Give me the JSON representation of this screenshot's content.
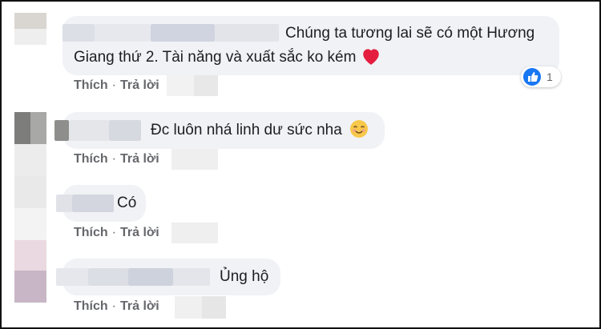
{
  "comments": [
    {
      "text_line1": "Chúng ta tương lai sẽ có một Hương",
      "text_line2": "Giang thứ 2. Tài năng và xuất sắc ko kém",
      "emoji": "red-heart",
      "reaction_count": "1"
    },
    {
      "text": "Đc luôn nhá linh dư sức nha",
      "emoji": "smiling-face-with-smiling-eyes"
    },
    {
      "text": "Có"
    },
    {
      "text": "Ủng hộ"
    }
  ],
  "actions": {
    "like": "Thích",
    "separator": "·",
    "reply": "Trả lời"
  },
  "colors": {
    "bubble": "#f0f2f5",
    "text": "#1c1e21",
    "action": "#65676b",
    "like_blue": "#1877f2",
    "heart_red": "#e41e3f"
  }
}
